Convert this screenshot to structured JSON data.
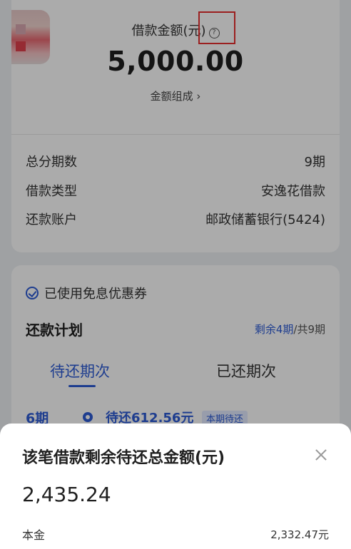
{
  "loan": {
    "amount_label": "借款金额(元)",
    "amount_value": "5,000.00",
    "composition_link": "金额组成 ›",
    "details": [
      {
        "label": "总分期数",
        "value": "9期"
      },
      {
        "label": "借款类型",
        "value": "安逸花借款"
      },
      {
        "label": "还款账户",
        "value": "邮政储蓄银行(5424)"
      }
    ]
  },
  "plan": {
    "coupon_text": "已使用免息优惠券",
    "title": "还款计划",
    "remaining_accent": "剩余4期",
    "remaining_total": "/共9期",
    "tabs": {
      "pending": "待还期次",
      "paid": "已还期次"
    },
    "current_installment": {
      "period": "6期",
      "amount_text": "待还612.56元",
      "badge": "本期待还"
    }
  },
  "sheet": {
    "title": "该笔借款剩余待还总金额(元)",
    "total": "2,435.24",
    "rows": [
      {
        "label": "本金",
        "value": "2,332.47元"
      }
    ]
  },
  "colors": {
    "accent": "#2d5bd6",
    "highlight": "#e82f2f"
  }
}
